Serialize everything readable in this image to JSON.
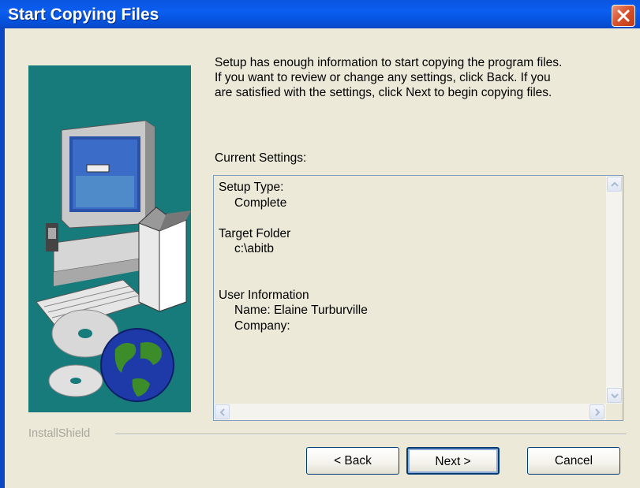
{
  "window": {
    "title": "Start Copying Files"
  },
  "intro_lines": [
    "Setup has enough information to start copying the program files.",
    "If you want to review or change any settings, click Back.  If you",
    "are satisfied with the settings, click Next to begin copying files."
  ],
  "current_settings_label": "Current Settings:",
  "settings": {
    "setup_type_label": "Setup Type:",
    "setup_type_value": "Complete",
    "target_folder_label": "Target Folder",
    "target_folder_value": "c:\\abitb",
    "user_info_label": "User Information",
    "user_name": "Name:  Elaine Turburville",
    "company": "Company:"
  },
  "brand": "InstallShield",
  "buttons": {
    "back": "< Back",
    "next": "Next >",
    "cancel": "Cancel"
  },
  "icons": [
    "close-icon",
    "scroll-up-icon",
    "scroll-down-icon",
    "scroll-left-icon",
    "scroll-right-icon",
    "computer-illustration",
    "globe-illustration",
    "cd-illustration"
  ],
  "colors": {
    "titlebar": "#0a55e0",
    "side_panel": "#177a7b",
    "dialog_bg": "#ece9d8",
    "close_button": "#d9552f"
  }
}
